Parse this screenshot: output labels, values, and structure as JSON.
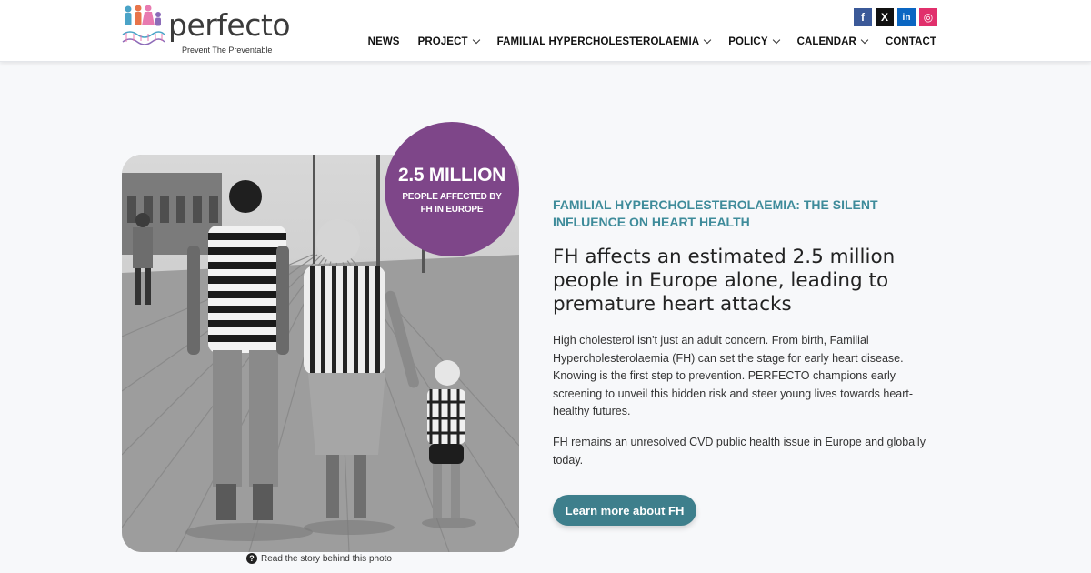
{
  "brand": {
    "name": "perfecto",
    "tagline": "Prevent The Preventable"
  },
  "social": [
    {
      "name": "facebook-icon",
      "glyph": "f"
    },
    {
      "name": "x-icon",
      "glyph": "X"
    },
    {
      "name": "linkedin-icon",
      "glyph": "in"
    },
    {
      "name": "instagram-icon",
      "glyph": "◎"
    }
  ],
  "nav": {
    "items": [
      {
        "label": "NEWS",
        "dropdown": false
      },
      {
        "label": "PROJECT",
        "dropdown": true
      },
      {
        "label": "FAMILIAL HYPERCHOLESTEROLAEMIA",
        "dropdown": true
      },
      {
        "label": "POLICY",
        "dropdown": true
      },
      {
        "label": "CALENDAR",
        "dropdown": true
      },
      {
        "label": "CONTACT",
        "dropdown": false
      }
    ]
  },
  "hero": {
    "stat_value": "2.5 MILLION",
    "stat_label": "PEOPLE AFFECTED BY FH IN EUROPE",
    "caption": "Read the story behind this photo",
    "kicker": "FAMILIAL HYPERCHOLESTEROLAEMIA: THE SILENT INFLUENCE ON HEART HEALTH",
    "headline": "FH affects an estimated 2.5 million people in Europe alone, leading to premature heart attacks",
    "paragraph1": "High cholesterol isn't just an adult concern. From birth, Familial Hypercholesterolaemia (FH) can set the stage for early heart disease. Knowing is the first step to prevention. PERFECTO champions early screening to unveil this hidden risk and steer young lives towards heart-healthy futures.",
    "paragraph2": "FH remains an unresolved CVD public health issue in Europe and globally today.",
    "cta_label": "Learn more about FH"
  },
  "colors": {
    "accent_teal": "#3e8b9a",
    "button_teal": "#3e7f8c",
    "bubble_purple": "#7e4689"
  }
}
